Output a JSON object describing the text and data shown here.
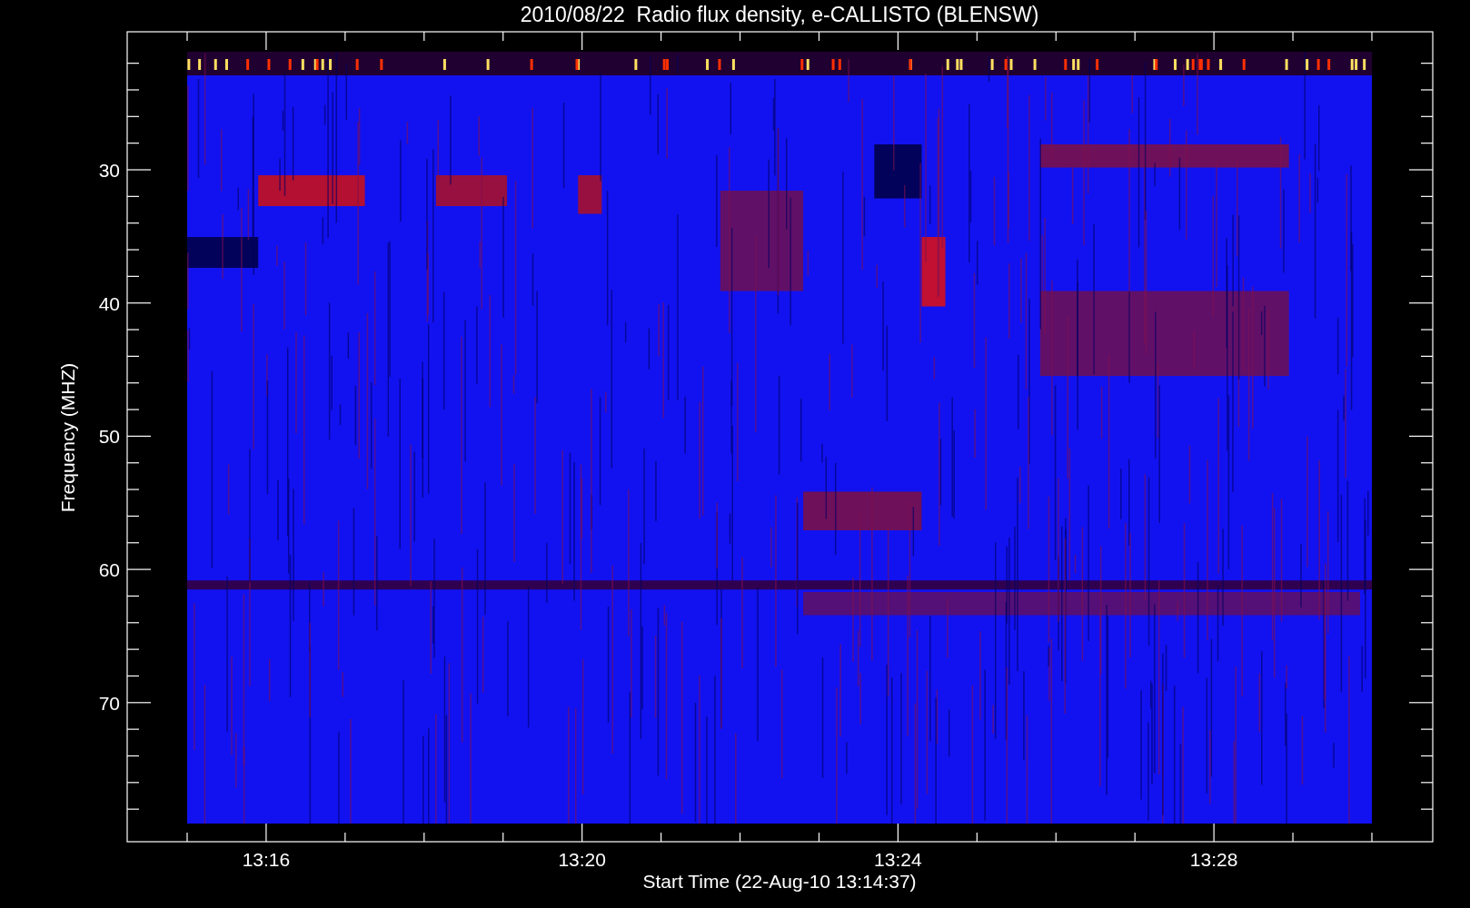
{
  "title": "2010/08/22  Radio flux density, e-CALLISTO (BLENSW)",
  "y_axis": {
    "label": "Frequency (MHZ)",
    "ticks": [
      "30",
      "40",
      "50",
      "60",
      "70"
    ]
  },
  "x_axis": {
    "label": "Start Time (22-Aug-10 13:14:37)",
    "ticks": [
      "13:16",
      "13:20",
      "13:24",
      "13:28"
    ]
  }
}
